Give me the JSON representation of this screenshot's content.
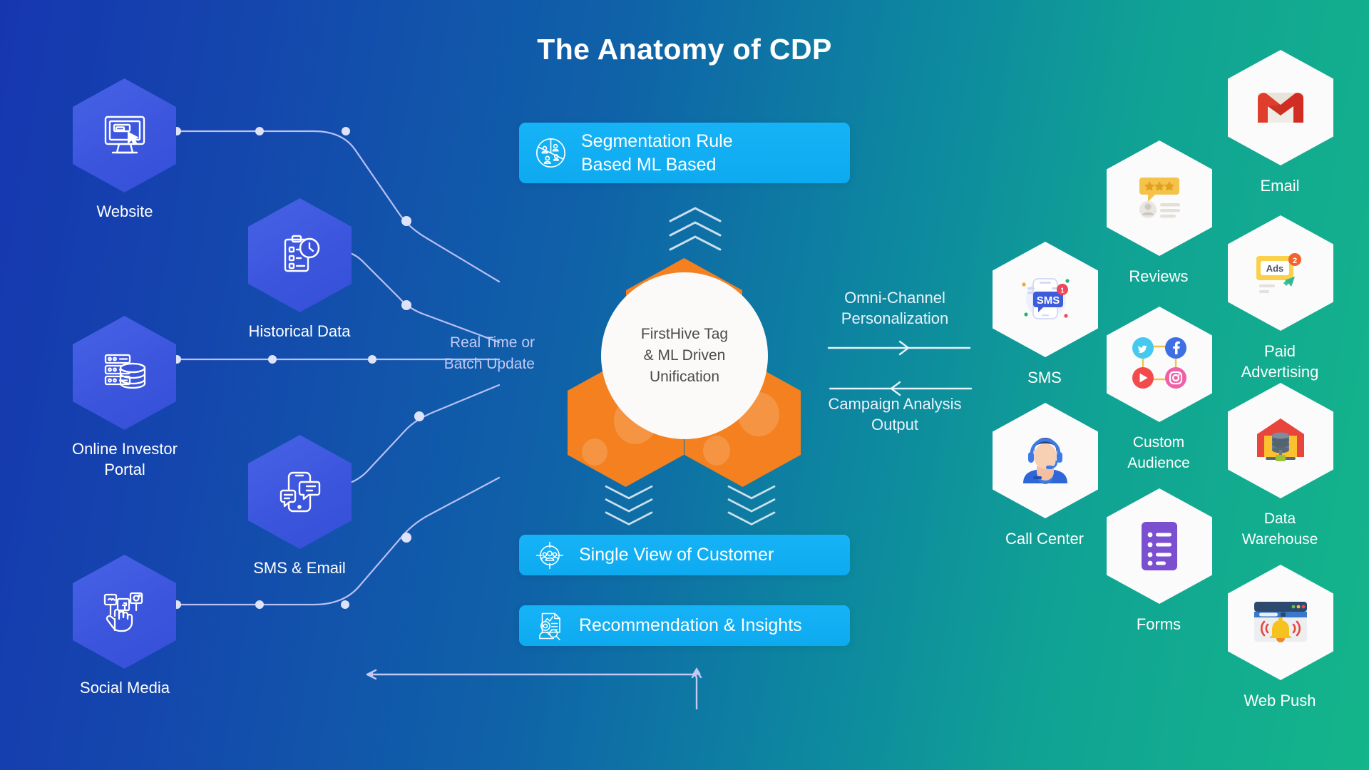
{
  "title": "The Anatomy of CDP",
  "colors": {
    "bg_left": "#1636b0",
    "bg_right": "#14b58a",
    "banner": "#0eaaf0",
    "core_hex": "#f4801f",
    "source_hex": "#4058e0",
    "dest_hex": "#fbfbfb",
    "line": "#b9c0f4",
    "core_text": "#4b4b4d"
  },
  "core": {
    "label": "FirstHive Tag\n& ML Driven\nUnification"
  },
  "sources": [
    {
      "label": "Website",
      "icon": "monitor-cursor-icon"
    },
    {
      "label": "Historical Data",
      "icon": "clipboard-clock-icon"
    },
    {
      "label": "Online Investor\nPortal",
      "icon": "database-server-icon"
    },
    {
      "label": "SMS & Email",
      "icon": "phone-chat-icon"
    },
    {
      "label": "Social Media",
      "icon": "social-hand-icon"
    }
  ],
  "flow_labels": {
    "left_line": "Real Time or\nBatch Update",
    "right_top": "Omni-Channel\nPersonalization",
    "right_bottom": "Campaign Analysis\nOutput"
  },
  "banners": [
    {
      "label": "Segmentation Rule\nBased ML Based",
      "icon": "segmentation-pie-people-icon"
    },
    {
      "label": "Single View of Customer",
      "icon": "target-people-icon"
    },
    {
      "label": "Recommendation & Insights",
      "icon": "report-search-icon"
    }
  ],
  "destinations": [
    {
      "label": "Email",
      "icon": "gmail-icon"
    },
    {
      "label": "Reviews",
      "icon": "star-review-icon"
    },
    {
      "label": "Paid\nAdvertising",
      "icon": "ads-icon"
    },
    {
      "label": "SMS",
      "icon": "sms-phone-icon"
    },
    {
      "label": "Custom\nAudience",
      "icon": "social-network-icon"
    },
    {
      "label": "Call Center",
      "icon": "headset-agent-icon"
    },
    {
      "label": "Data\nWarehouse",
      "icon": "warehouse-database-icon"
    },
    {
      "label": "Forms",
      "icon": "form-document-icon"
    },
    {
      "label": "Web Push",
      "icon": "browser-bell-icon"
    }
  ],
  "ads_badge": "Ads"
}
